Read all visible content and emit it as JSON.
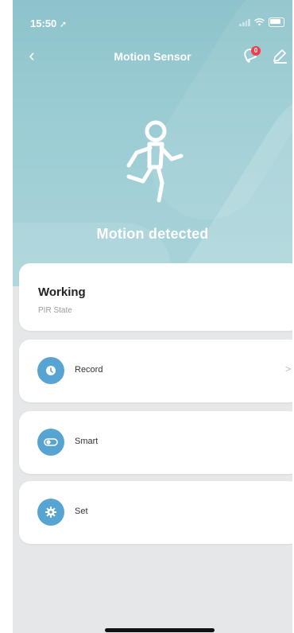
{
  "status_bar": {
    "time": "15:50",
    "location_arrow": "location-arrow-icon",
    "battery": "battery-icon"
  },
  "header": {
    "back_glyph": "‹",
    "title": "Motion Sensor",
    "notification_badge": "0"
  },
  "hero": {
    "status": "Motion detected",
    "icon": "person-running-icon"
  },
  "state_card": {
    "value": "Working",
    "label": "PIR State"
  },
  "menu": [
    {
      "label": "Record",
      "icon": "clock-icon",
      "chevron": ">"
    },
    {
      "label": "Smart",
      "icon": "toggle-icon"
    },
    {
      "label": "Set",
      "icon": "gear-icon"
    }
  ],
  "colors": {
    "hero": "#9ccdd4",
    "accent": "#57a4d3",
    "badge": "#ee3f4a",
    "background": "#e6e7e9"
  }
}
